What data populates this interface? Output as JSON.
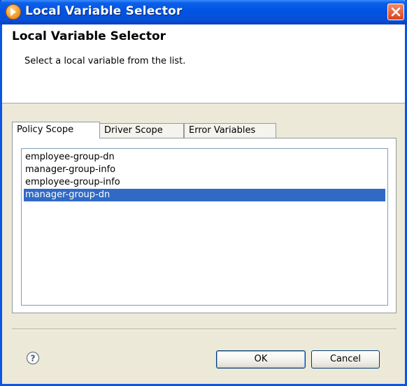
{
  "window": {
    "title": "Local Variable Selector",
    "title_icon": "novell-designer-icon",
    "close_icon": "close-icon"
  },
  "header": {
    "title": "Local Variable Selector",
    "message": "Select a local variable from the list."
  },
  "tabs": [
    {
      "label": "Policy Scope",
      "active": true
    },
    {
      "label": "Driver Scope",
      "active": false
    },
    {
      "label": "Error Variables",
      "active": false
    }
  ],
  "variables": {
    "items": [
      "employee-group-dn",
      "manager-group-info",
      "employee-group-info",
      "manager-group-dn"
    ],
    "selected": "manager-group-dn"
  },
  "footer": {
    "help_icon": "help-icon",
    "ok_label": "OK",
    "cancel_label": "Cancel"
  },
  "colors": {
    "selection": "#316ac5",
    "titlebar": "#0054e3"
  }
}
